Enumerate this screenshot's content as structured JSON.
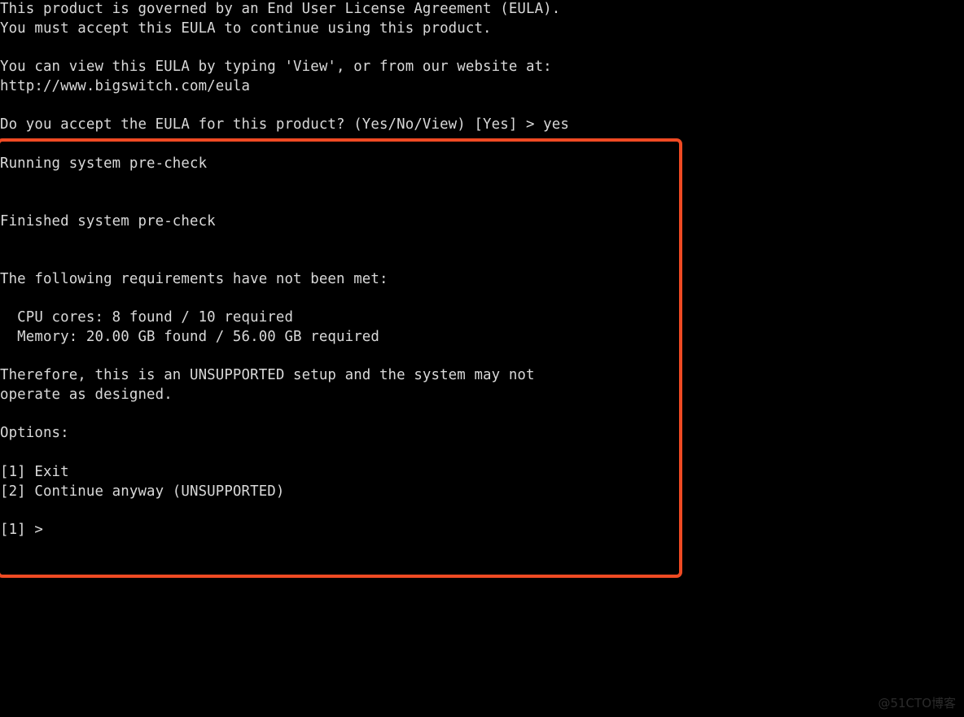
{
  "terminal": {
    "background_color": "#000000",
    "text_color": "#d9d9d9",
    "eula_block": {
      "line_1": "This product is governed by an End User License Agreement (EULA).",
      "line_2": "You must accept this EULA to continue using this product.",
      "line_3": "",
      "line_4": "You can view this EULA by typing 'View', or from our website at:",
      "line_5": "http://www.bigswitch.com/eula",
      "line_6": "",
      "line_7": "Do you accept the EULA for this product? (Yes/No/View) [Yes] > yes"
    },
    "precheck_block": {
      "line_1": "Running system pre-check",
      "line_2": "",
      "line_3": "",
      "line_4": "Finished system pre-check",
      "line_5": "",
      "line_6": "",
      "line_7": "The following requirements have not been met:",
      "line_8": "",
      "line_9": "  CPU cores: 8 found / 10 required",
      "line_10": "  Memory: 20.00 GB found / 56.00 GB required",
      "line_11": "",
      "line_12": "Therefore, this is an UNSUPPORTED setup and the system may not",
      "line_13": "operate as designed.",
      "line_14": "",
      "line_15": "Options:",
      "line_16": "",
      "line_17": "[1] Exit",
      "line_18": "[2] Continue anyway (UNSUPPORTED)",
      "line_19": "",
      "line_20": "[1] >"
    },
    "prompt": {
      "eula_answer_value": "yes",
      "eula_default": "[Yes]",
      "option_default": "[1]",
      "option_caret": ">"
    }
  },
  "annotation": {
    "highlight_color": "#ef4a23",
    "highlight_label": "system-precheck-highlight"
  },
  "watermark": {
    "text": "@51CTO博客",
    "color": "#2b2b2b"
  }
}
